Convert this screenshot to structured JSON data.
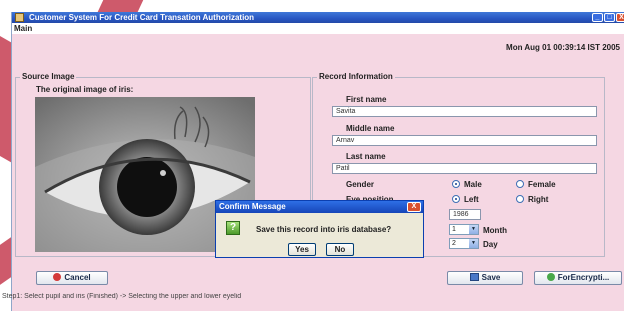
{
  "window": {
    "title": "Customer System For Credit Card Transation Authorization",
    "min_symbol": "_",
    "max_symbol": "□",
    "close_symbol": "X"
  },
  "menu": {
    "main": "Main"
  },
  "header": {
    "datetime": "Mon Aug 01 00:39:14 IST 2005"
  },
  "source": {
    "group_title": "Source Image",
    "caption": "The original image of iris:"
  },
  "record": {
    "group_title": "Record Information",
    "first_name_label": "First name",
    "first_name_value": "Savita",
    "middle_name_label": "Middle name",
    "middle_name_value": "Arnav",
    "last_name_label": "Last name",
    "last_name_value": "Patil",
    "gender_label": "Gender",
    "gender_options": [
      "Male",
      "Female"
    ],
    "gender_selected": "Male",
    "eye_label": "Eye position",
    "eye_options": [
      "Left",
      "Right"
    ],
    "eye_selected": "Left",
    "year_value": "1986",
    "month_value": "1",
    "month_label": "Month",
    "day_value": "2",
    "day_label": "Day"
  },
  "buttons": {
    "cancel": "Cancel",
    "save": "Save",
    "forencrypt": "ForEncrypti..."
  },
  "status": {
    "text": "Step1: Select pupil and iris (Finished) -> Selecting the upper and lower eyelid"
  },
  "dialog": {
    "title": "Confirm Message",
    "icon": "?",
    "message": "Save this record into iris database?",
    "yes": "Yes",
    "no": "No",
    "close_symbol": "X"
  },
  "colors": {
    "window_bg": "#f5d7e3",
    "titlebar": "#2856c2",
    "decor": "#ce5a6b"
  }
}
